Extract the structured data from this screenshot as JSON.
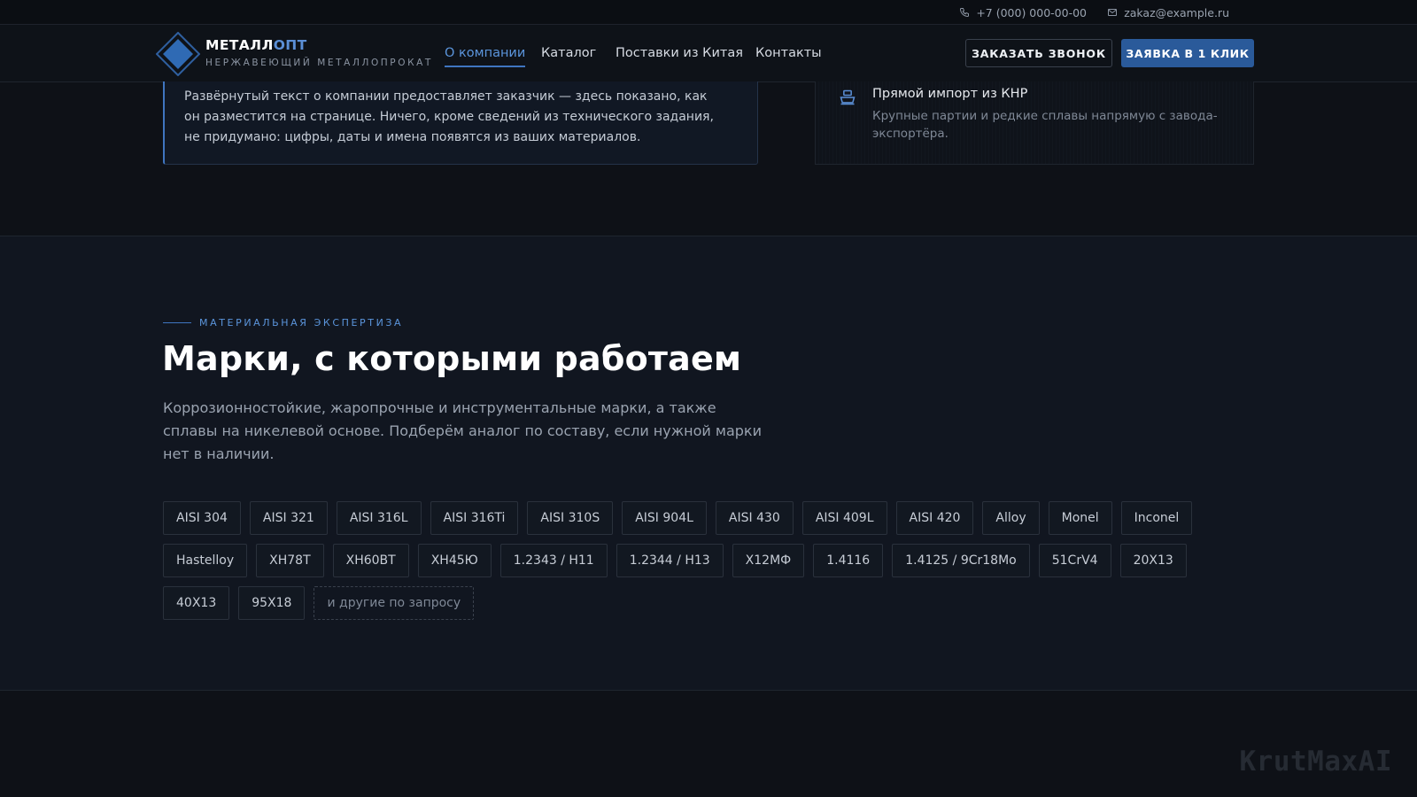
{
  "topbar": {
    "phone": "+7 (000) 000-00-00",
    "email": "zakaz@example.ru"
  },
  "header": {
    "logo_name_main": "МЕТАЛЛ",
    "logo_name_accent": "ОПТ",
    "logo_subtitle": "НЕРЖАВЕЮЩИЙ МЕТАЛЛОПРОКАТ",
    "nav": [
      {
        "label": "О компании",
        "active": true
      },
      {
        "label": "Каталог",
        "active": false
      },
      {
        "label": "Поставки из Китая",
        "active": false
      },
      {
        "label": "Контакты",
        "active": false
      }
    ],
    "call_button": "ЗАКАЗАТЬ ЗВОНОК",
    "order_button": "ЗАЯВКА В 1 КЛИК"
  },
  "about": {
    "text": "Развёрнутый текст о компании предоставляет заказчик — здесь показано, как он разместится на странице. Ничего, кроме сведений из технического задания, не придумано: цифры, даты и имена появятся из ваших материалов."
  },
  "import": {
    "title": "Прямой импорт из КНР",
    "description": "Крупные партии и редкие сплавы напрямую с завода-экспортёра."
  },
  "grades": {
    "eyebrow": "МАТЕРИАЛЬНАЯ ЭКСПЕРТИЗА",
    "title": "Марки, с которыми работаем",
    "lead": "Коррозионностойкие, жаропрочные и инструментальные марки, а также сплавы на никелевой основе. Подберём аналог по составу, если нужной марки нет в наличии.",
    "chips": [
      "AISI 304",
      "AISI 321",
      "AISI 316L",
      "AISI 316Ti",
      "AISI 310S",
      "AISI 904L",
      "AISI 430",
      "AISI 409L",
      "AISI 420",
      "Alloy",
      "Monel",
      "Inconel",
      "Hastelloy",
      "ХН78Т",
      "ХН60ВТ",
      "ХН45Ю",
      "1.2343 / H11",
      "1.2344 / H13",
      "Х12МФ",
      "1.4116",
      "1.4125 / 9Cr18Mo",
      "51CrV4",
      "20Х13",
      "40Х13",
      "95Х18"
    ],
    "more_chip": "и другие по запросу"
  },
  "watermark": "KrutMaxAI",
  "colors": {
    "accent": "#3f75c0",
    "background": "#0e1117",
    "section_background": "#111620"
  }
}
